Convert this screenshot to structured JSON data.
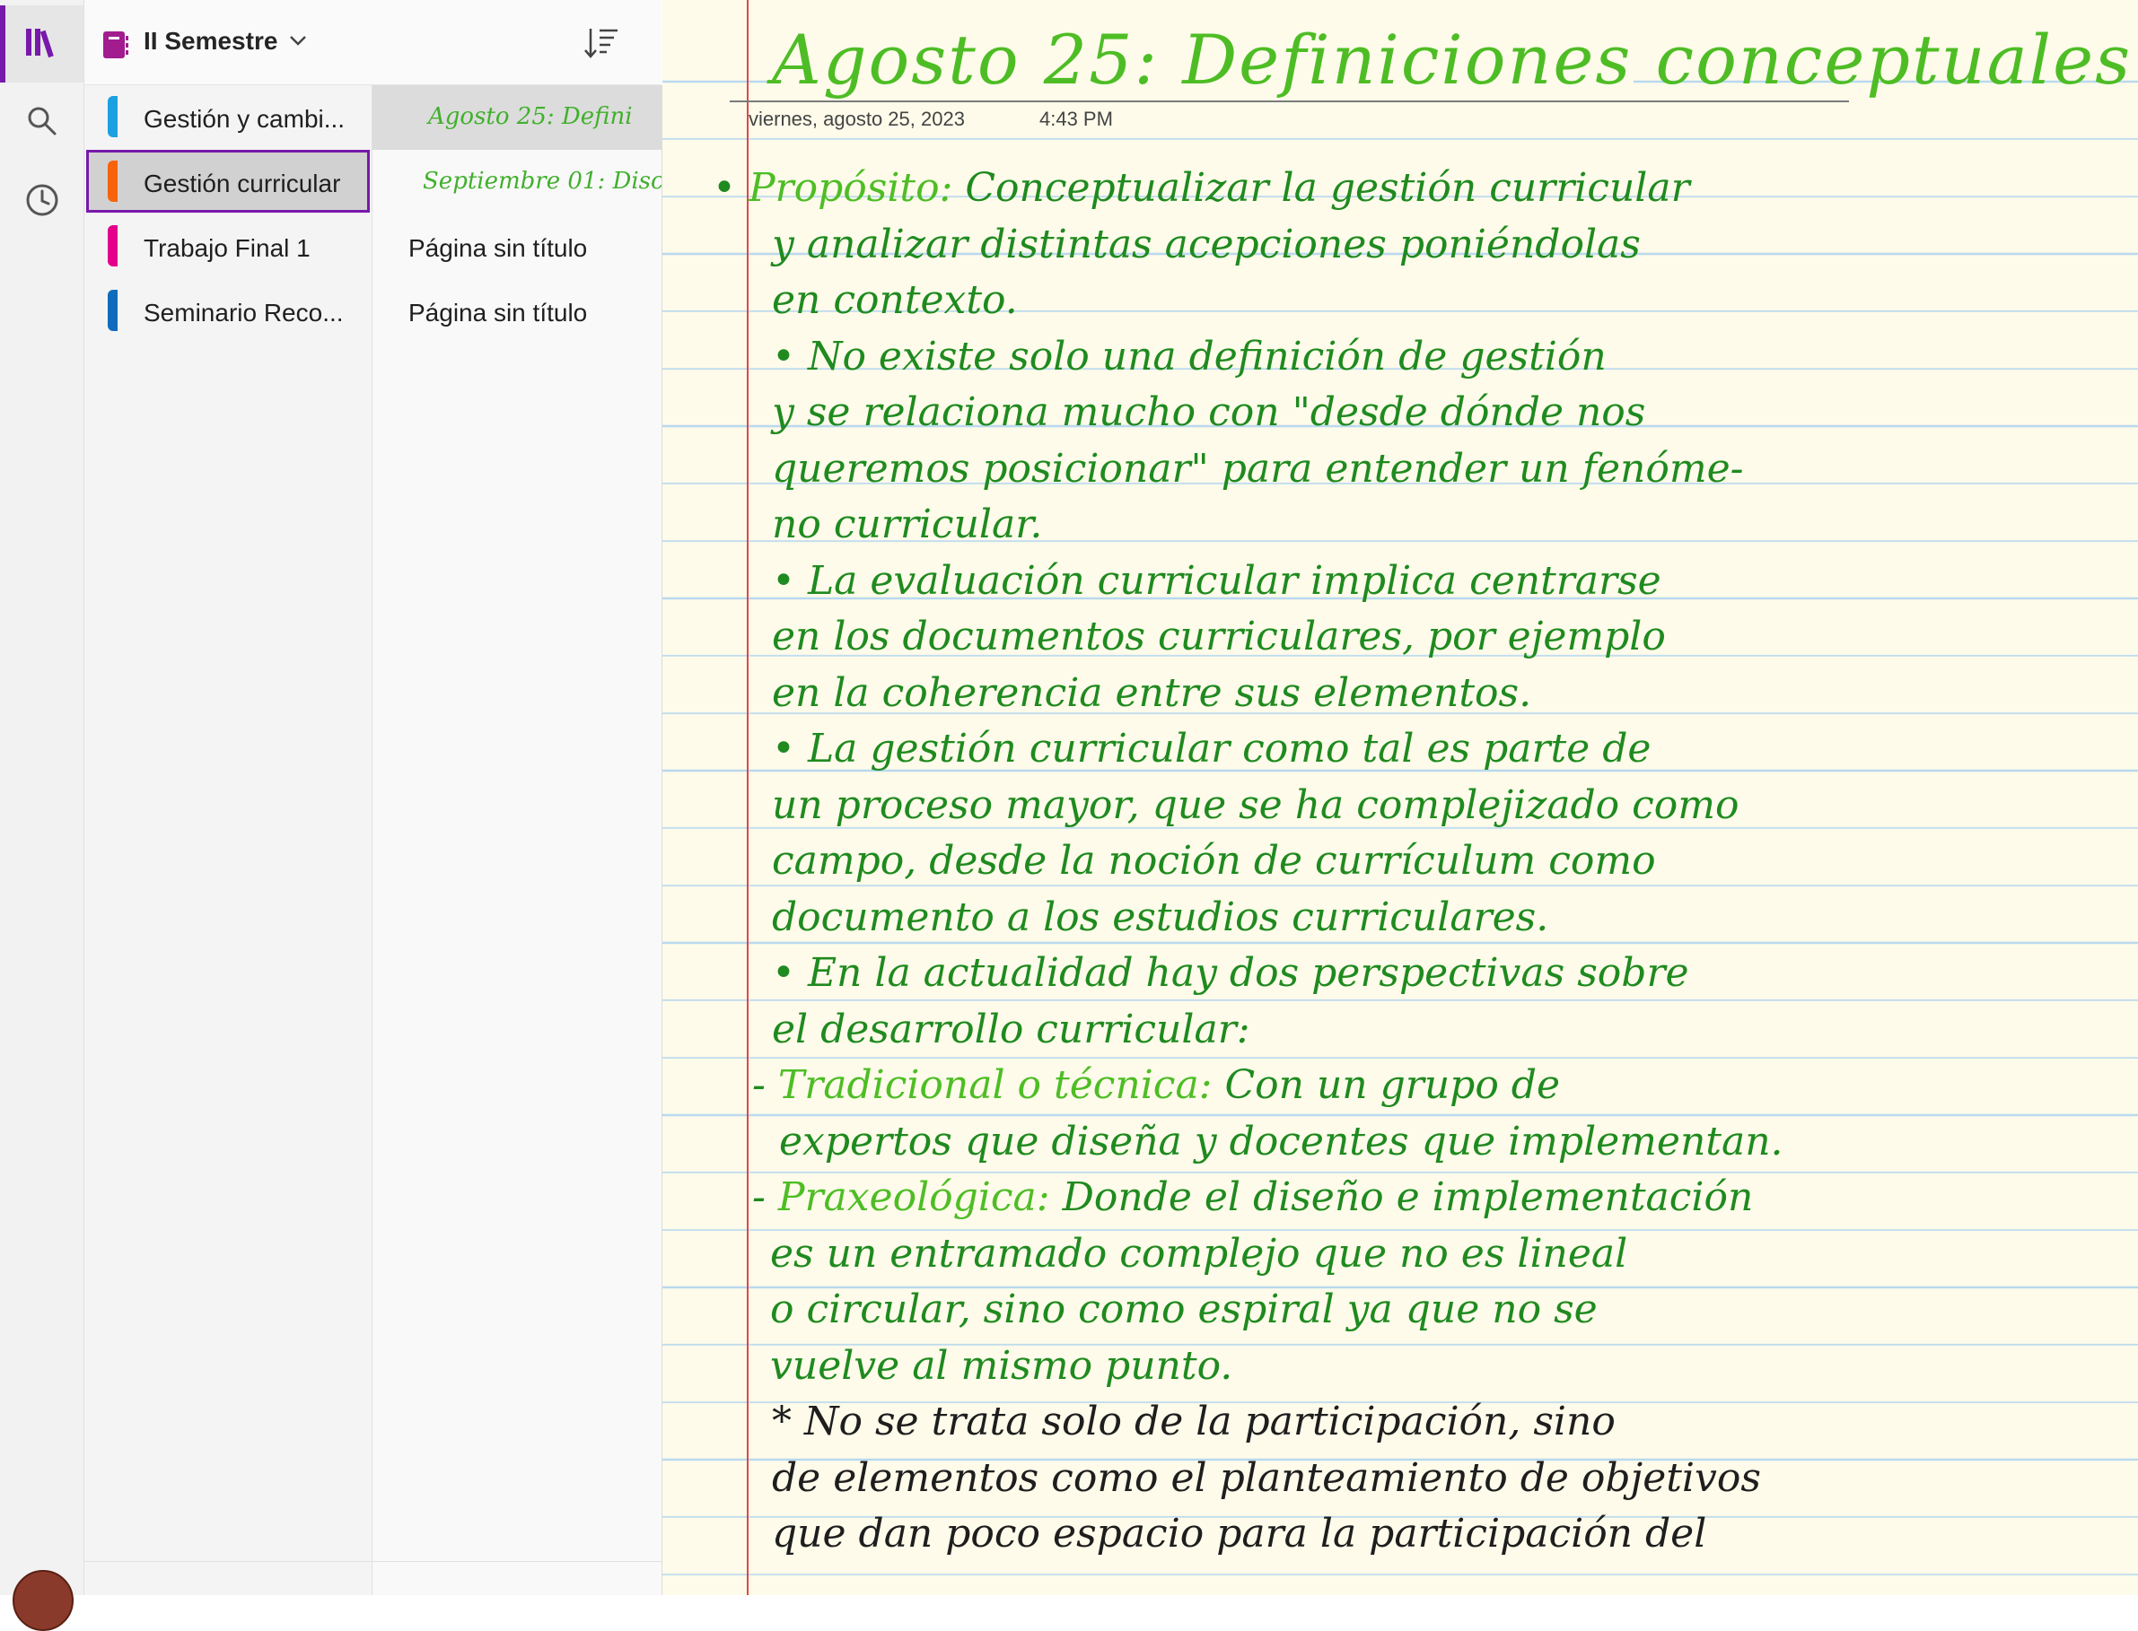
{
  "notebook": {
    "title": "II Semestre"
  },
  "sections": [
    {
      "label": "Gestión y cambi...",
      "color": "#1ba1e2"
    },
    {
      "label": "Gestión curricular",
      "color": "#f7630c"
    },
    {
      "label": "Trabajo Final 1",
      "color": "#e3008c"
    },
    {
      "label": "Seminario Reco...",
      "color": "#0f6cbd"
    }
  ],
  "pages": [
    {
      "label": "Agosto 25: Defini"
    },
    {
      "label": "Septiembre 01: Disc"
    },
    {
      "label": "Página sin título"
    },
    {
      "label": "Página sin título"
    }
  ],
  "note": {
    "title": "Agosto 25: Definiciones conceptuales",
    "date": "viernes, agosto 25, 2023",
    "time": "4:43 PM",
    "lines": [
      {
        "label": "Propósito:",
        "text": " Conceptualizar la gestión curricular"
      },
      {
        "text": "y analizar distintas acepciones poniéndolas"
      },
      {
        "text": "en contexto."
      },
      {
        "text": "• No existe solo una definición de gestión"
      },
      {
        "text": "y se relaciona mucho con \"desde dónde nos"
      },
      {
        "text": "queremos posicionar\" para entender un fenóme-"
      },
      {
        "text": "no curricular."
      },
      {
        "text": "• La evaluación curricular implica centrarse"
      },
      {
        "text": "en los documentos curriculares, por ejemplo"
      },
      {
        "text": "en la coherencia entre sus elementos."
      },
      {
        "text": "• La gestión curricular como tal es parte de"
      },
      {
        "text": "un proceso mayor, que se ha complejizado como"
      },
      {
        "text": "campo, desde la noción de currículum como"
      },
      {
        "text": "documento a los estudios curriculares."
      },
      {
        "text": "• En la actualidad hay dos perspectivas sobre"
      },
      {
        "text": "el desarrollo curricular:"
      },
      {
        "label": "Tradicional o técnica:",
        "text": " Con un grupo de"
      },
      {
        "text": "expertos que diseña y docentes que implementan."
      },
      {
        "label": "Praxeológica:",
        "text": " Donde el diseño e implementación"
      },
      {
        "text": "es un entramado complejo que no es lineal"
      },
      {
        "text": "o circular, sino como espiral ya que no se"
      },
      {
        "text": "vuelve al mismo punto."
      },
      {
        "text": "* No se trata solo de la participación, sino"
      },
      {
        "text": "de elementos como el planteamiento de objetivos"
      },
      {
        "text": "que dan poco espacio para la participación del"
      }
    ]
  },
  "colors": {
    "accent": "#7719aa",
    "ink_dark_green": "#1f8a1f",
    "ink_light_green": "#4ebd25",
    "paper": "#fefbea",
    "rule_lines": "#b9d9ee",
    "margin_line": "#e0464b"
  },
  "icons": [
    "notebooks-icon",
    "search-icon",
    "recent-clock-icon",
    "notebook-icon",
    "chevron-down-icon",
    "sort-icon"
  ]
}
